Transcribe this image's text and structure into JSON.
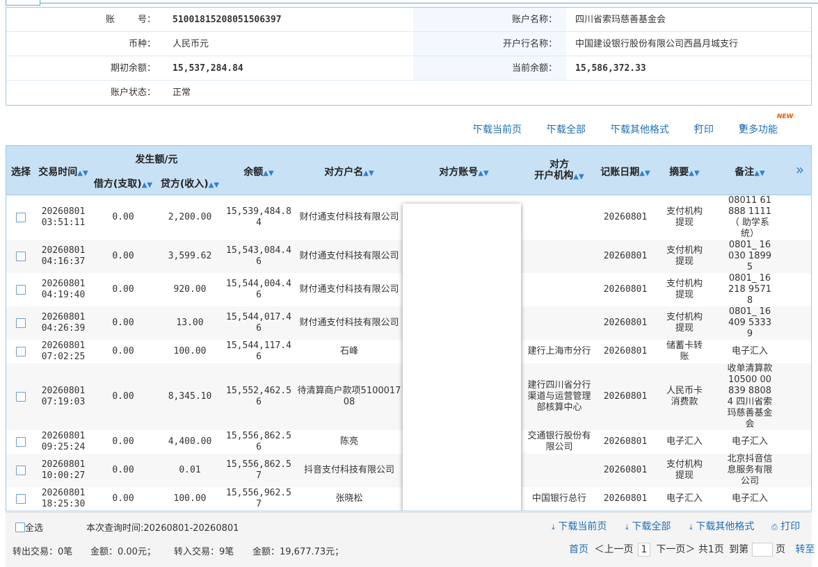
{
  "account": {
    "acct_no_label": "账        号：",
    "acct_no": "51001815208051506397",
    "acct_name_label": "账户名称：",
    "acct_name": "四川省索玛慈善基金会",
    "currency_label": "币种：",
    "currency": "人民币元",
    "bank_label": "开户行名称：",
    "bank": "中国建设银行股份有限公司西昌月城支行",
    "opening_label": "期初余额：",
    "opening": "15,537,284.84",
    "current_label": "当前余额：",
    "current": "15,586,372.33",
    "status_label": "账户状态：",
    "status": "正常"
  },
  "actions": {
    "download_page": "下载当前页",
    "download_all": "下载全部",
    "download_other": "下载其他格式",
    "print": "打印",
    "more": "更多功能",
    "new_badge": "NEW"
  },
  "columns": {
    "select": "选择",
    "time": "交易时间",
    "amount_group": "发生额/元",
    "debit": "借方(支取)",
    "credit": "贷方(收入)",
    "balance": "余额",
    "cp_name": "对方户名",
    "cp_account": "对方账号",
    "cp_bank_1": "对方",
    "cp_bank_2": "开户机构",
    "post_date": "记账日期",
    "summary": "摘要",
    "remark": "备注",
    "expand": "»"
  },
  "rows": [
    {
      "date": "20260801",
      "time": "03:51:11",
      "debit": "0.00",
      "credit": "2,200.00",
      "balance": "15,539,484.84",
      "cp_name": "财付通支付科技有限公司",
      "cp_bank": "",
      "post_date": "20260801",
      "summary": "支付机构提现",
      "remark": "08011 61888 1111（ 助学系统）"
    },
    {
      "date": "20260801",
      "time": "04:16:37",
      "debit": "0.00",
      "credit": "3,599.62",
      "balance": "15,543,084.46",
      "cp_name": "财付通支付科技有限公司",
      "cp_bank": "",
      "post_date": "20260801",
      "summary": "支付机构提现",
      "remark": "0801_ 16030 18995"
    },
    {
      "date": "20260801",
      "time": "04:19:40",
      "debit": "0.00",
      "credit": "920.00",
      "balance": "15,544,004.46",
      "cp_name": "财付通支付科技有限公司",
      "cp_bank": "",
      "post_date": "20260801",
      "summary": "支付机构提现",
      "remark": "0801_ 16218 95718"
    },
    {
      "date": "20260801",
      "time": "04:26:39",
      "debit": "0.00",
      "credit": "13.00",
      "balance": "15,544,017.46",
      "cp_name": "财付通支付科技有限公司",
      "cp_bank": "",
      "post_date": "20260801",
      "summary": "支付机构提现",
      "remark": "0801_ 16409 53339"
    },
    {
      "date": "20260801",
      "time": "07:02:25",
      "debit": "0.00",
      "credit": "100.00",
      "balance": "15,544,117.46",
      "cp_name": "石峰",
      "cp_bank": "建行上海市分行",
      "post_date": "20260801",
      "summary": "储蓄卡转账",
      "remark": "电子汇入"
    },
    {
      "date": "20260801",
      "time": "07:19:03",
      "debit": "0.00",
      "credit": "8,345.10",
      "balance": "15,552,462.56",
      "cp_name": "待清算商户款项510001708",
      "cp_bank": "建行四川省分行渠道与运营管理部核算中心",
      "post_date": "20260801",
      "summary": "人民币卡消费款",
      "remark": "收单清算款 10500 00839 88084 四川省索玛慈善基金会"
    },
    {
      "date": "20260801",
      "time": "09:25:24",
      "debit": "0.00",
      "credit": "4,400.00",
      "balance": "15,556,862.56",
      "cp_name": "陈亮",
      "cp_bank": "交通银行股份有限公司",
      "post_date": "20260801",
      "summary": "电子汇入",
      "remark": "电子汇入"
    },
    {
      "date": "20260801",
      "time": "10:00:27",
      "debit": "0.00",
      "credit": "0.01",
      "balance": "15,556,862.57",
      "cp_name": "抖音支付科技有限公司",
      "cp_bank": "",
      "post_date": "20260801",
      "summary": "支付机构提现",
      "remark": "北京抖音信息服务有限公司"
    },
    {
      "date": "20260801",
      "time": "18:25:30",
      "debit": "0.00",
      "credit": "100.00",
      "balance": "15,556,962.57",
      "cp_name": "张晓松",
      "cp_bank": "中国银行总行",
      "post_date": "20260801",
      "summary": "电子汇入",
      "remark": "电子汇入"
    }
  ],
  "footer": {
    "select_all": "全选",
    "query_time": "本次查询时间:20260801-20260801",
    "download_page": "下载当前页",
    "download_all": "下载全部",
    "download_other": "下载其他格式",
    "print": "打印",
    "out_tx": "转出交易：0笔",
    "out_amt": "金额：0.00元；",
    "in_tx": "转入交易：9笔",
    "in_amt": "金额：19,677.73元；",
    "first": "首页",
    "prev": "＜上一页",
    "page": "1",
    "next": "下一页＞",
    "total": "共1页",
    "goto": "到第",
    "page_unit": "页",
    "go": "转至"
  }
}
